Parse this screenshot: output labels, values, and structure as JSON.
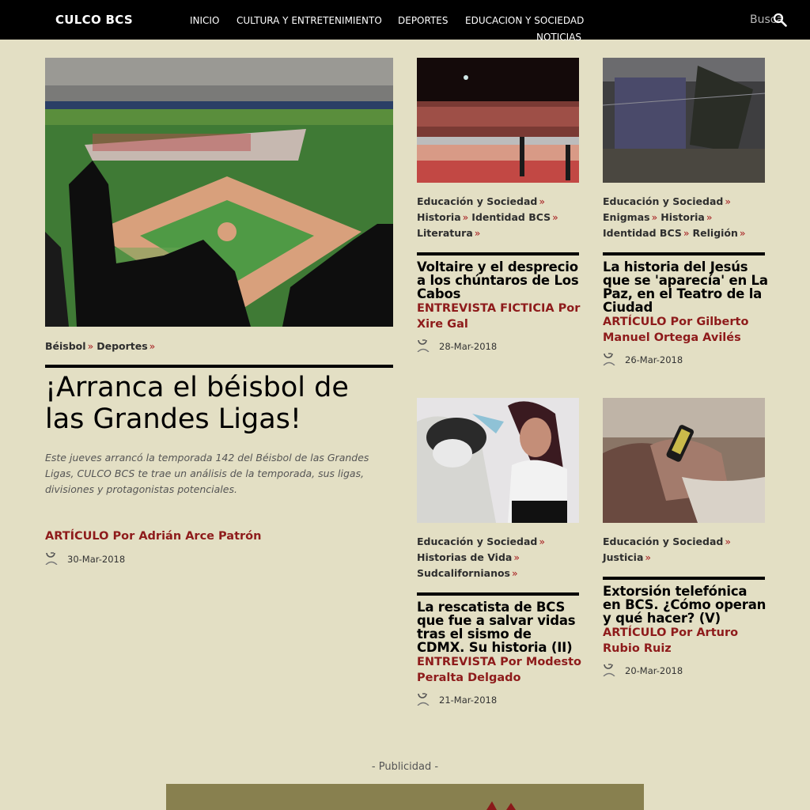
{
  "site": {
    "brand": "CULCO BCS"
  },
  "nav": {
    "inicio": "INICIO",
    "cultura": "CULTURA Y ENTRETENIMIENTO",
    "deportes": "DEPORTES",
    "educacion": "EDUCACION Y SOCIEDAD",
    "noticias": "NOTICIAS"
  },
  "search": {
    "label": "Busca"
  },
  "lead": {
    "categories": [
      "Béisbol",
      "Deportes"
    ],
    "title": "¡Arranca el béisbol de las Grandes Ligas!",
    "description": "Este jueves arrancó la temporada 142 del Béisbol de las Grandes Ligas, CULCO BCS te trae un análisis de la temporada, sus ligas, divisiones y protagonistas potenciales.",
    "byline": "ARTÍCULO Por Adrián Arce Patrón",
    "date": "30-Mar-2018"
  },
  "articles": [
    {
      "categories": [
        "Educación y Sociedad",
        "Historia",
        "Identidad BCS",
        "Literatura"
      ],
      "title": "Voltaire y el desprecio a los chúntaros de Los Cabos",
      "byline": "ENTREVISTA FICTICIA Por Xire Gal",
      "date": "28-Mar-2018"
    },
    {
      "categories": [
        "Educación y Sociedad",
        "Enigmas",
        "Historia",
        "Identidad BCS",
        "Religión"
      ],
      "title": "La historia del Jesús que se 'aparecía' en La Paz, en el Teatro de la Ciudad",
      "byline": "ARTÍCULO Por Gilberto Manuel Ortega Avilés",
      "date": "26-Mar-2018"
    },
    {
      "categories": [
        "Educación y Sociedad",
        "Historias de Vida",
        "Sudcalifornianos"
      ],
      "title": "La rescatista de BCS que fue a salvar vidas tras el sismo de CDMX. Su historia (II)",
      "byline": "ENTREVISTA Por Modesto Peralta Delgado",
      "date": "21-Mar-2018"
    },
    {
      "categories": [
        "Educación y Sociedad",
        "Justicia"
      ],
      "title": "Extorsión telefónica en BCS. ¿Cómo operan y qué hacer? (V)",
      "byline": "ARTÍCULO Por Arturo Rubio Ruiz",
      "date": "20-Mar-2018"
    }
  ],
  "ad": {
    "label": "- Publicidad -"
  },
  "colors": {
    "background": "#e3dfc4",
    "topbar": "#000000",
    "accent": "#8e1b1b",
    "separator": "#a4161a"
  },
  "icons": {
    "search": "search-icon",
    "date": "clock-icon",
    "separator": "raquo"
  }
}
